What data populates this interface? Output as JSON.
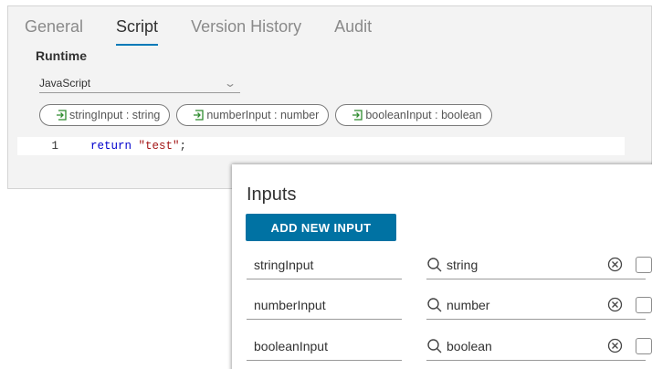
{
  "tabs": [
    {
      "label": "General",
      "active": false
    },
    {
      "label": "Script",
      "active": true
    },
    {
      "label": "Version History",
      "active": false
    },
    {
      "label": "Audit",
      "active": false
    }
  ],
  "runtime": {
    "label": "Runtime",
    "selected": "JavaScript"
  },
  "input_chips": [
    {
      "label": "stringInput : string"
    },
    {
      "label": "numberInput : number"
    },
    {
      "label": "booleanInput : boolean"
    }
  ],
  "code": {
    "line_number": "1",
    "keyword": "return",
    "string_literal": "\"test\"",
    "terminator": ";"
  },
  "inputs_dialog": {
    "title": "Inputs",
    "add_button_label": "ADD NEW INPUT",
    "rows": [
      {
        "name": "stringInput",
        "type": "string"
      },
      {
        "name": "numberInput",
        "type": "number"
      },
      {
        "name": "booleanInput",
        "type": "boolean"
      }
    ]
  },
  "colors": {
    "accent": "#0072a3",
    "active_tab_underline": "#0079b8",
    "chip_icon": "#2e8b2e"
  }
}
